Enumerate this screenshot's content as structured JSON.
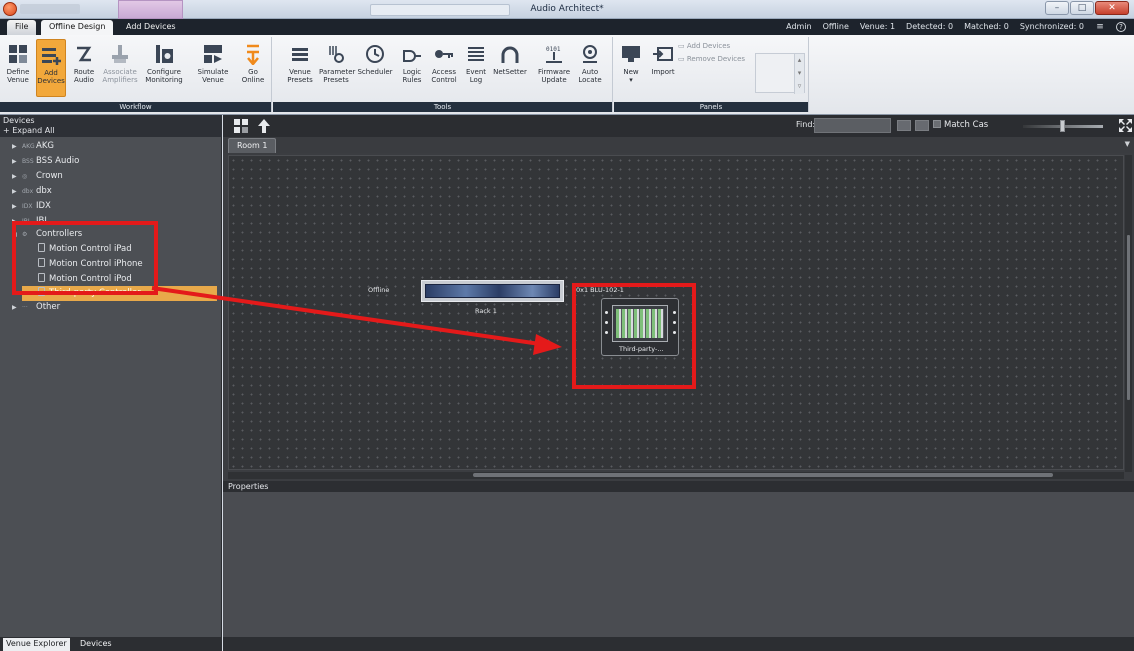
{
  "window": {
    "title": "Audio Architect*",
    "controls": [
      "–",
      "□",
      "✕"
    ]
  },
  "tabs": {
    "file": "File",
    "offline_design": "Offline Design",
    "add_devices": "Add Devices"
  },
  "status": {
    "admin": "Admin",
    "offline": "Offline",
    "venue": "Venue: 1",
    "detected": "Detected: 0",
    "matched": "Matched: 0",
    "synchronized": "Synchronized: 0",
    "help": "?"
  },
  "ribbon": {
    "workflow_label": "Workflow",
    "tools_label": "Tools",
    "panels_label": "Panels",
    "define_venue": "Define\nVenue",
    "add_devices": "Add\nDevices",
    "route_audio": "Route\nAudio",
    "associate_amplifiers": "Associate\nAmplifiers",
    "configure_monitoring": "Configure\nMonitoring",
    "simulate_venue": "Simulate\nVenue",
    "go_online": "Go\nOnline",
    "venue_presets": "Venue\nPresets",
    "parameter_presets": "Parameter\nPresets",
    "scheduler": "Scheduler",
    "logic_rules": "Logic\nRules",
    "access_control": "Access\nControl",
    "event_log": "Event\nLog",
    "netsetter": "NetSetter",
    "firmware_update": "Firmware\nUpdate",
    "auto_locate": "Auto\nLocate",
    "new": "New\n▾",
    "import": "Import",
    "add_devices_small": "Add Devices",
    "remove_devices_small": "Remove Devices"
  },
  "devices_panel": {
    "title": "Devices",
    "expand_all": "+ Expand All",
    "brands": [
      {
        "logo": "AKG",
        "label": "AKG"
      },
      {
        "logo": "BSS",
        "label": "BSS Audio"
      },
      {
        "logo": "◎",
        "label": "Crown"
      },
      {
        "logo": "dbx",
        "label": "dbx"
      },
      {
        "logo": "IDX",
        "label": "IDX"
      },
      {
        "logo": "JBL",
        "label": "JBL"
      }
    ],
    "controllers": {
      "label": "Controllers",
      "children": [
        "Motion Control iPad",
        "Motion Control iPhone",
        "Motion Control iPod",
        "Third-party Controller"
      ]
    },
    "other": {
      "logo": "···",
      "label": "Other"
    },
    "bottom_tabs": {
      "venue_explorer": "Venue Explorer",
      "devices": "Devices"
    }
  },
  "canvas": {
    "find_label": "Find:",
    "find_value": "",
    "match_case": "Match Cas",
    "room_tab": "Room 1",
    "rack_status": "Offline",
    "rack_label": "Rack 1",
    "controller_header": "0x1  BLU-102-1",
    "controller_label": "Third-party-..."
  },
  "properties": {
    "title": "Properties"
  },
  "colors": {
    "accent_orange": "#f2a83b",
    "annotation_red": "#e41a1a"
  }
}
